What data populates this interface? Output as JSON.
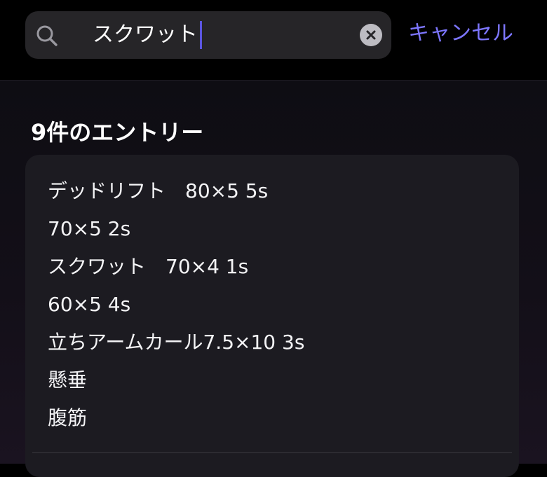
{
  "search": {
    "query": "スクワット",
    "cancel_label": "キャンセル"
  },
  "results": {
    "count_label": "9件のエントリー",
    "entry_lines": [
      "デッドリフト　80×5 5s",
      "70×5 2s",
      "スクワット　70×4 1s",
      "60×5 4s",
      "立ちアームカール7.5×10 3s",
      "懸垂",
      "腹筋"
    ]
  },
  "colors": {
    "accent": "#7d76ff",
    "caret": "#5b55e0",
    "card": "#1c1b21",
    "field": "#262528"
  },
  "icons": {
    "search": "magnifying-glass",
    "clear": "x-circle-fill"
  }
}
